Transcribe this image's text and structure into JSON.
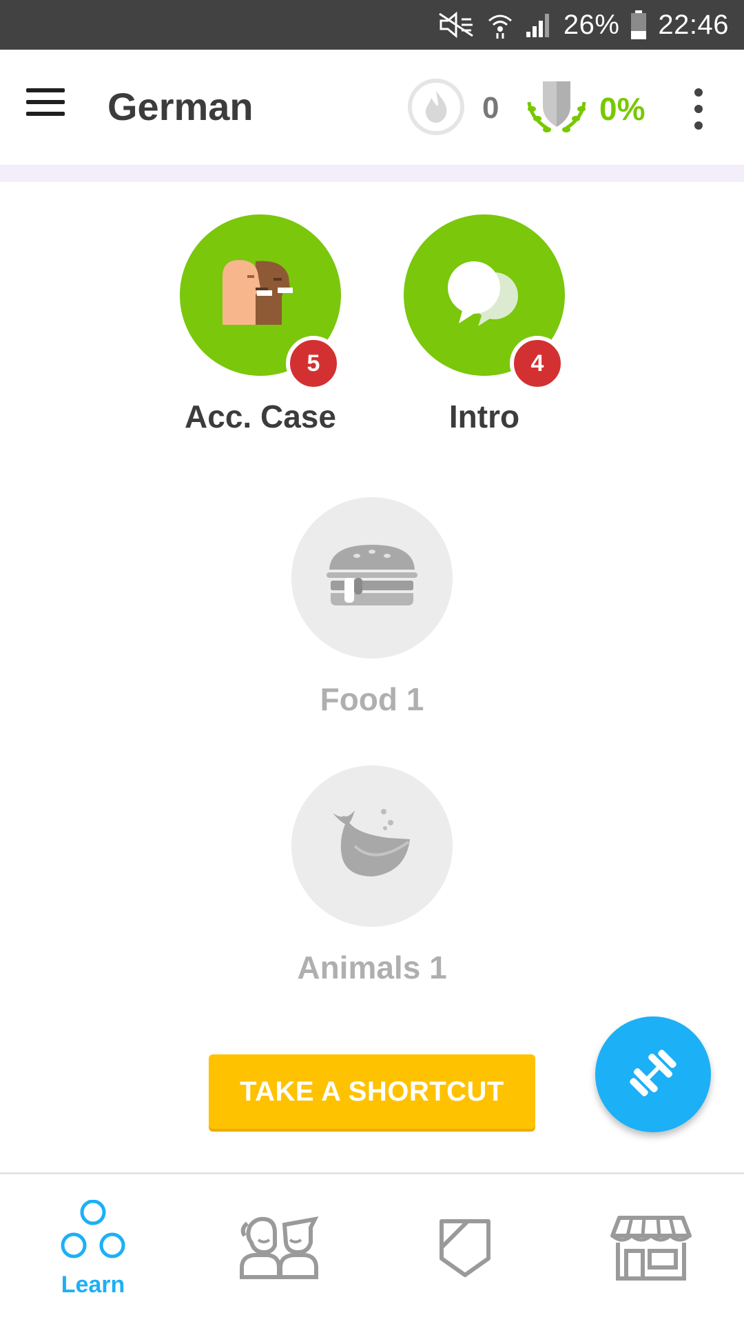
{
  "status_bar": {
    "battery_percent": "26%",
    "time": "22:46"
  },
  "header": {
    "course_title": "German",
    "streak_count": "0",
    "crown_percent": "0%"
  },
  "skills": [
    {
      "label": "Acc. Case",
      "badge": "5",
      "state": "unlocked",
      "icon": "people-talking-icon"
    },
    {
      "label": "Intro",
      "badge": "4",
      "state": "unlocked",
      "icon": "speech-bubbles-icon"
    },
    {
      "label": "Food 1",
      "state": "locked",
      "icon": "burger-icon"
    },
    {
      "label": "Animals 1",
      "state": "locked",
      "icon": "whale-icon"
    }
  ],
  "actions": {
    "shortcut_label": "TAKE A SHORTCUT",
    "practice_icon": "dumbbell-icon"
  },
  "bottom_nav": {
    "tabs": [
      {
        "label": "Learn",
        "icon": "learn-circles-icon",
        "active": true
      },
      {
        "label": "",
        "icon": "club-people-icon",
        "active": false
      },
      {
        "label": "",
        "icon": "league-shield-icon",
        "active": false
      },
      {
        "label": "",
        "icon": "shop-icon",
        "active": false
      }
    ]
  },
  "colors": {
    "status_bar": "#424242",
    "green": "#7ac70c",
    "red_badge": "#d33131",
    "yellow_button": "#ffc200",
    "blue": "#1cb0f6",
    "locked_grey": "#ececec"
  }
}
